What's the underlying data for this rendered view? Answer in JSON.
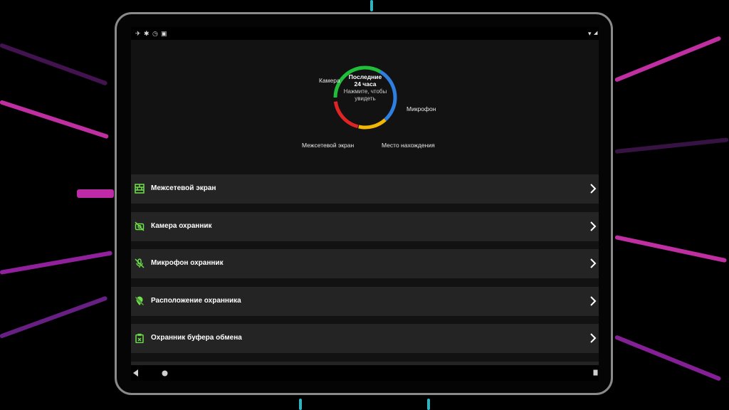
{
  "background": {
    "accent_colors": [
      "#ff3fd8",
      "#3ff0ff",
      "#ffffff"
    ]
  },
  "status_bar": {
    "left_icons": [
      "notification-icon",
      "bluetooth-icon",
      "alarm-icon",
      "nfc-icon"
    ],
    "right_icons": [
      "wifi-icon",
      "signal-icon"
    ]
  },
  "dashboard": {
    "title_line1": "Последние",
    "title_line2": "24 часа",
    "subtitle_line1": "Нажмите, чтобы",
    "subtitle_line2": "увидеть",
    "labels": {
      "camera": "Камера",
      "microphone": "Микрофон",
      "firewall": "Межсетевой экран",
      "location": "Место нахождения"
    },
    "segment_colors": {
      "green": "#1fbf3a",
      "blue": "#2f7fe0",
      "yellow": "#f2b705",
      "red": "#e02424"
    }
  },
  "list": {
    "items": [
      {
        "label": "Межсетевой экран",
        "icon": "firewall-icon"
      },
      {
        "label": "Камера охранник",
        "icon": "camera-off-icon"
      },
      {
        "label": "Микрофон охранник",
        "icon": "mic-off-icon"
      },
      {
        "label": "Расположение охранника",
        "icon": "location-off-icon"
      },
      {
        "label": "Охранник буфера обмена",
        "icon": "clipboard-icon"
      },
      {
        "label": "",
        "icon": "more-icon"
      }
    ],
    "accent_color": "#6ee04a"
  }
}
